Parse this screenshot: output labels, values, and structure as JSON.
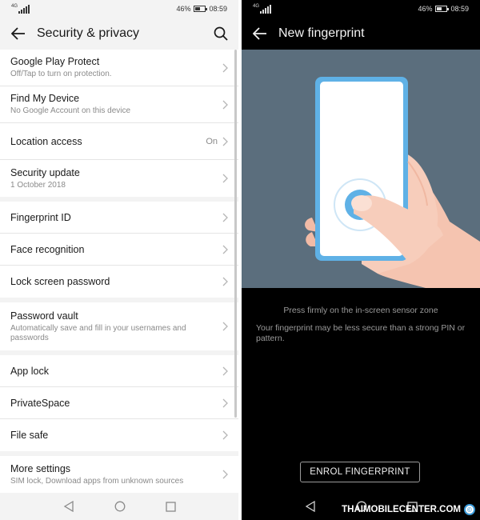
{
  "colors": {
    "accent": "#3a9ad9",
    "illustration_bg": "#5b6e7d",
    "phone_border": "#5fb1e6"
  },
  "left": {
    "status": {
      "network": "4G",
      "battery": "46%",
      "time": "08:59"
    },
    "title": "Security & privacy",
    "sections": [
      {
        "items": [
          {
            "title": "Google Play Protect",
            "subtitle": "Off/Tap to turn on protection."
          },
          {
            "title": "Find My Device",
            "subtitle": "No Google Account on this device"
          },
          {
            "title": "Location access",
            "value": "On"
          },
          {
            "title": "Security update",
            "subtitle": "1 October 2018"
          }
        ]
      },
      {
        "items": [
          {
            "title": "Fingerprint ID"
          },
          {
            "title": "Face recognition"
          },
          {
            "title": "Lock screen password"
          }
        ]
      },
      {
        "items": [
          {
            "title": "Password vault",
            "subtitle": "Automatically save and fill in your usernames and passwords"
          }
        ]
      },
      {
        "items": [
          {
            "title": "App lock"
          },
          {
            "title": "PrivateSpace"
          },
          {
            "title": "File safe"
          }
        ]
      },
      {
        "items": [
          {
            "title": "More settings",
            "subtitle": "SIM lock, Download apps from unknown sources"
          }
        ]
      }
    ]
  },
  "right": {
    "status": {
      "network": "4G",
      "battery": "46%",
      "time": "08:59"
    },
    "title": "New fingerprint",
    "hint_primary": "Press firmly on the in-screen sensor zone",
    "hint_secondary": "Your fingerprint may be less secure than a strong PIN or pattern.",
    "enrol_label": "ENROL FINGERPRINT",
    "watermark": "THAIMOBILECENTER.COM",
    "watermark_symbol": "©"
  },
  "icons": [
    "back-arrow-icon",
    "search-icon",
    "chevron-right-icon",
    "nav-back-icon",
    "nav-home-icon",
    "nav-recents-icon"
  ]
}
